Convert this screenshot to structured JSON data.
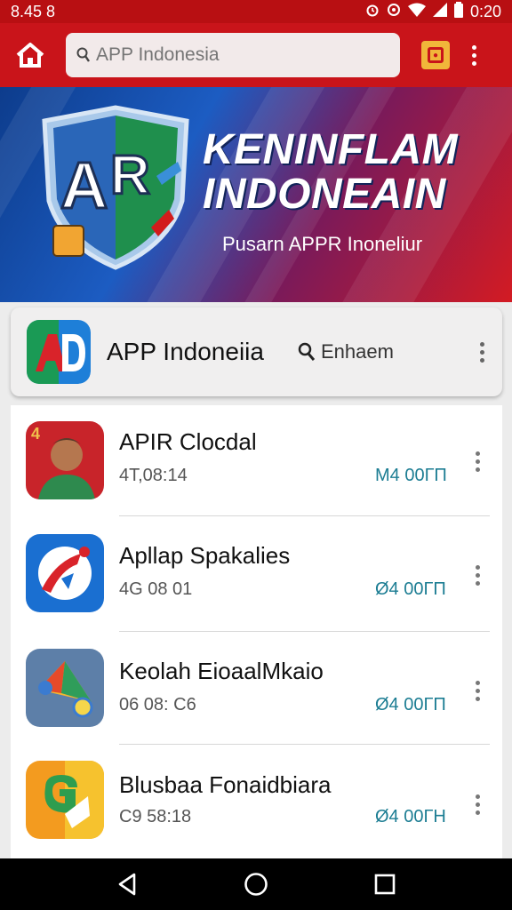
{
  "status_bar": {
    "left_time": "8.45 8",
    "right_time": "0:20",
    "icons": [
      "alarm-icon",
      "vibrate-icon",
      "wifi-icon",
      "signal-icon",
      "battery-icon"
    ]
  },
  "app_bar": {
    "search_placeholder": "APP Indonesia",
    "icons": [
      "home-icon",
      "search-icon",
      "tabs-icon",
      "more-vert-icon"
    ]
  },
  "banner": {
    "title_line1": "KENINFLAM",
    "title_line2": "INDONEAIN",
    "subtitle": "Pusarn APPR Inoneliur",
    "shield_letters": "AR"
  },
  "header": {
    "app_name": "APP Indoneiia",
    "enhance_label": "Enhaem"
  },
  "apps": [
    {
      "title": "APIR Clocdal",
      "meta": "4T,08:14",
      "size": "M4 00ГП"
    },
    {
      "title": "Apllap Spakalies",
      "meta": "4G 08 01",
      "size": "Ø4 00ГП"
    },
    {
      "title": "Keolah EioaalMkaio",
      "meta": "06 08: C6",
      "size": "Ø4 00ГП"
    },
    {
      "title": "Blusbaa Fonaidbiara",
      "meta": "C9 58:18",
      "size": "Ø4 00ГН"
    }
  ],
  "colors": {
    "app_bar": "#c9141a",
    "status_bar": "#b80f12",
    "size_text": "#1c7d93"
  }
}
